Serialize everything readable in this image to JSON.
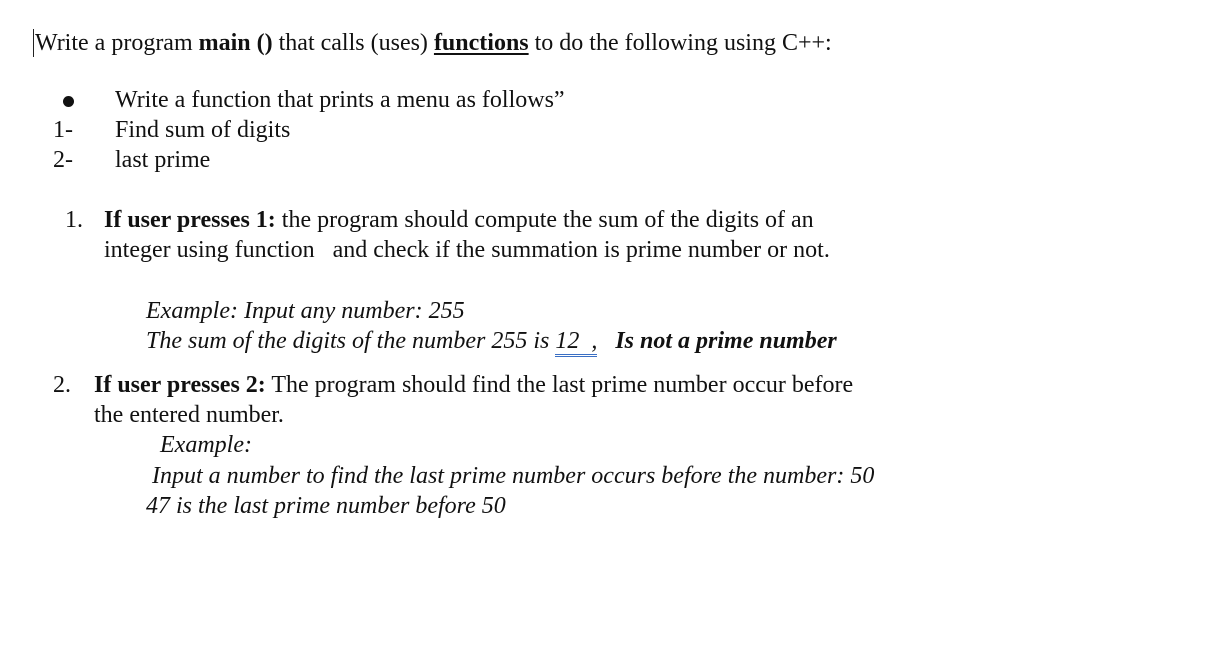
{
  "intro": {
    "part1": "Write a program ",
    "main_bold": "main ()",
    "part2": " that calls (uses) ",
    "functions_bold": "functions",
    "part3": " to do the following using C++:"
  },
  "menu": {
    "bullet_text": "Write a function that prints a menu as follows”",
    "items": [
      {
        "marker": "1-",
        "text": "Find sum of digits"
      },
      {
        "marker": "2-",
        "text": "last prime"
      }
    ]
  },
  "tasks": [
    {
      "marker": "1.",
      "heading": "If user presses 1:",
      "line1": " the program should compute the sum of the digits of an",
      "line2": "integer using function   and check if the summation is prime number or not.",
      "example_line1": "Example: Input any number: 255",
      "example_line2_prefix": "The sum of the digits of the number 255 is ",
      "example_value": "12  ,",
      "example_result": "Is not a prime number"
    },
    {
      "marker": "2.",
      "heading": "If user presses 2:",
      "line1": " The program should find the last prime number occur before",
      "line2": "the entered number.",
      "example_label": "Example:",
      "example_line1": "Input a number to find the last prime number occurs before the number: 50",
      "example_line2": "47 is the last prime number before 50"
    }
  ]
}
